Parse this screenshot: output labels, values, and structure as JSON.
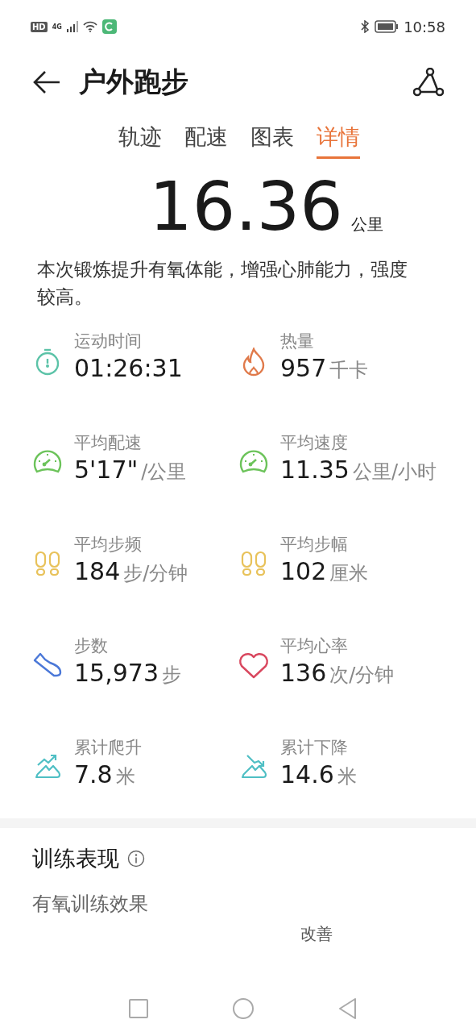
{
  "status_bar": {
    "network_badge": "HD",
    "network_type": "4G",
    "time": "10:58"
  },
  "header": {
    "title": "户外跑步"
  },
  "tabs": [
    {
      "label": "轨迹",
      "selected": false
    },
    {
      "label": "配速",
      "selected": false
    },
    {
      "label": "图表",
      "selected": false
    },
    {
      "label": "详情",
      "selected": true
    }
  ],
  "summary": {
    "distance": "16.36",
    "unit": "公里",
    "description": "本次锻炼提升有氧体能，增强心肺能力，强度较高。"
  },
  "stats": [
    {
      "kind": "timer",
      "color": "#5cc3a8",
      "label": "运动时间",
      "value": "01:26:31"
    },
    {
      "kind": "flame",
      "color": "#e07a4b",
      "label": "热量",
      "value": "957",
      "unit": "千卡"
    },
    {
      "kind": "gauge",
      "color": "#6cc35a",
      "label": "平均配速",
      "value": "5'17\"",
      "unit": "/公里"
    },
    {
      "kind": "gauge",
      "color": "#6cc35a",
      "label": "平均速度",
      "value": "11.35",
      "unit": "公里/小时"
    },
    {
      "kind": "feet",
      "color": "#e8c25a",
      "label": "平均步频",
      "value": "184",
      "unit": "步/分钟"
    },
    {
      "kind": "feet",
      "color": "#e8c25a",
      "label": "平均步幅",
      "value": "102",
      "unit": "厘米"
    },
    {
      "kind": "shoe",
      "color": "#4b78d8",
      "label": "步数",
      "value": "15,973",
      "unit": "步"
    },
    {
      "kind": "heart",
      "color": "#d9485f",
      "label": "平均心率",
      "value": "136",
      "unit": "次/分钟"
    },
    {
      "kind": "climb",
      "color": "#4fbfc4",
      "label": "累计爬升",
      "value": "7.8",
      "unit": "米"
    },
    {
      "kind": "descend",
      "color": "#4fbfc4",
      "label": "累计下降",
      "value": "14.6",
      "unit": "米"
    }
  ],
  "training": {
    "title": "训练表现",
    "subtitle": "有氧训练效果",
    "level_label": "改善"
  }
}
